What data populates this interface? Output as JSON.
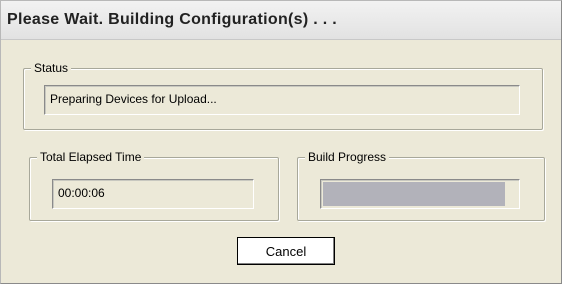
{
  "window": {
    "title": "Please Wait. Building Configuration(s) . . ."
  },
  "status": {
    "label": "Status",
    "value": "Preparing Devices for Upload..."
  },
  "elapsed": {
    "label": "Total Elapsed Time",
    "value": "00:00:06"
  },
  "build_progress": {
    "label": "Build Progress",
    "fraction": 0.94
  },
  "actions": {
    "cancel_label": "Cancel"
  },
  "colors": {
    "dialog_bg": "#ece9d8",
    "progress_fill": "#b2b2ba"
  }
}
